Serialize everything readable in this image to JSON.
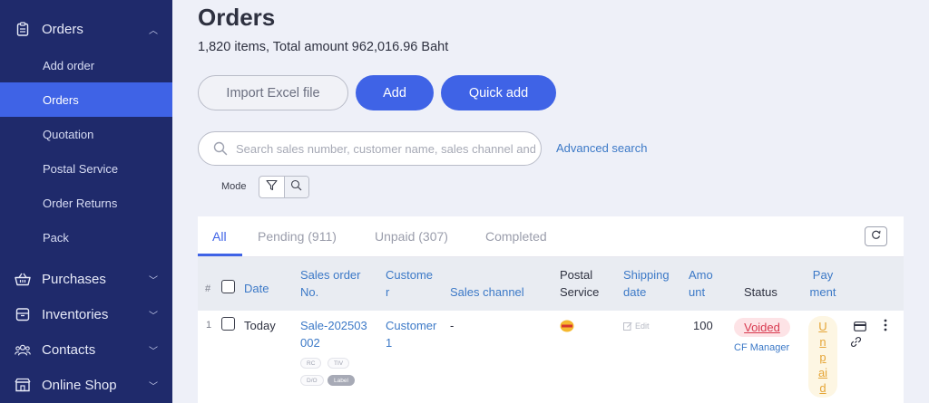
{
  "sidebar": {
    "orders_group": {
      "label": "Orders",
      "icon": "clipboard-icon",
      "expanded": true
    },
    "sub_items": [
      {
        "label": "Add order",
        "active": false
      },
      {
        "label": "Orders",
        "active": true
      },
      {
        "label": "Quotation",
        "active": false
      },
      {
        "label": "Postal Service",
        "active": false
      },
      {
        "label": "Order Returns",
        "active": false
      },
      {
        "label": "Pack",
        "active": false
      }
    ],
    "groups": [
      {
        "label": "Purchases",
        "icon": "basket-icon"
      },
      {
        "label": "Inventories",
        "icon": "box-icon"
      },
      {
        "label": "Contacts",
        "icon": "people-icon"
      },
      {
        "label": "Online Shop",
        "icon": "shop-icon"
      }
    ]
  },
  "page": {
    "title": "Orders",
    "summary": "1,820 items, Total amount 962,016.96 Baht"
  },
  "actions": {
    "import_label": "Import Excel file",
    "add_label": "Add",
    "quick_add_label": "Quick add"
  },
  "search": {
    "placeholder": "Search sales number, customer name, sales channel and",
    "value": "",
    "advanced_label": "Advanced search"
  },
  "mode": {
    "label": "Mode"
  },
  "tabs": [
    {
      "label": "All",
      "active": true
    },
    {
      "label": "Pending (911)",
      "active": false
    },
    {
      "label": "Unpaid (307)",
      "active": false
    },
    {
      "label": "Completed",
      "active": false
    }
  ],
  "table": {
    "columns": {
      "hash": "#",
      "date": "Date",
      "sales_order_line1": "Sales order",
      "sales_order_line2": "No.",
      "customer_line1": "Custome",
      "customer_line2": "r",
      "sales_channel": "Sales channel",
      "postal_line1": "Postal",
      "postal_line2": "Service",
      "shipping_line1": "Shipping",
      "shipping_line2": "date",
      "amount_line1": "Amo",
      "amount_line2": "unt",
      "status": "Status",
      "payment_line1": "Pay",
      "payment_line2": "ment"
    },
    "rows": [
      {
        "index": "1",
        "date": "Today",
        "sales_no_line1": "Sale-202503",
        "sales_no_line2": "002",
        "customer_line1": "Customer",
        "customer_line2": "1",
        "sales_channel": "-",
        "shipping_edit": "Edit",
        "amount": "100",
        "status": "Voided",
        "status_by": "CF Manager",
        "payment": "Unpaid",
        "badges": [
          "RC",
          "TIV",
          "D/O",
          "Label"
        ]
      }
    ]
  },
  "colors": {
    "sidebar_bg": "#1f2a6b",
    "accent": "#3f63e6",
    "link": "#3c79c7",
    "voided": "#d8394f",
    "unpaid": "#e5a537"
  }
}
